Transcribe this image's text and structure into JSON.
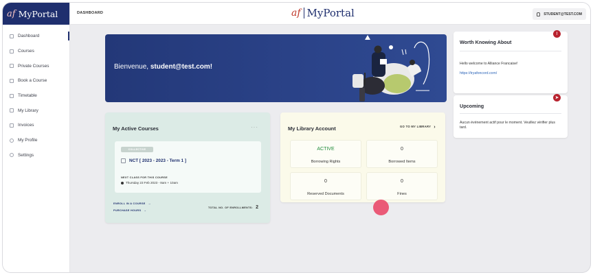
{
  "brand": {
    "mark": "af",
    "name": "MyPortal"
  },
  "topbar": {
    "breadcrumb": "DASHBOARD",
    "user": "STUDENT@TEST.COM"
  },
  "sidebar": {
    "items": [
      {
        "label": "Dashboard",
        "icon": "dashboard-icon"
      },
      {
        "label": "Courses",
        "icon": "courses-icon"
      },
      {
        "label": "Private Courses",
        "icon": "private-courses-icon"
      },
      {
        "label": "Book a Course",
        "icon": "book-course-icon"
      },
      {
        "label": "Timetable",
        "icon": "calendar-icon"
      },
      {
        "label": "My Library",
        "icon": "library-icon"
      },
      {
        "label": "Invoices",
        "icon": "invoice-icon"
      },
      {
        "label": "My Profile",
        "icon": "profile-icon"
      },
      {
        "label": "Settings",
        "icon": "gear-icon"
      }
    ]
  },
  "hero": {
    "greeting": "Bienvenue,",
    "user": "student@test.com!"
  },
  "courses": {
    "title": "My Active Courses",
    "menu": "···",
    "tag": "COLLECTIVE",
    "course_name": "NCT [ 2023 - 2023 - Term 1 ]",
    "next_class_label": "NEXT CLASS FOR THIS COURSE",
    "next_class_value": "Thursday 23 Feb 2023 - 8am + 10am",
    "enroll_link": "ENROLL IN A COURSE",
    "purchase_link": "PURCHASE HOURS",
    "enroll_count_label": "TOTAL NO. OF ENROLLMENTS:",
    "enroll_count": "2"
  },
  "library": {
    "title": "My Library Account",
    "go_link": "GO TO MY LIBRARY",
    "stats": [
      {
        "value": "ACTIVE",
        "label": "Borrowing Rights"
      },
      {
        "value": "0",
        "label": "Borrowed Items"
      },
      {
        "value": "0",
        "label": "Reserved Documents"
      },
      {
        "value": "0",
        "label": "Fines"
      }
    ]
  },
  "worth": {
    "title": "Worth Knowing About",
    "text": "Hello welcome to Alliance Francaise!",
    "link": "https://tryafoncord.com/"
  },
  "upcoming": {
    "title": "Upcoming",
    "text": "Aucun événement actif pour le moment. Veuillez vérifier plus tard."
  },
  "colors": {
    "brand_navy": "#1f2f6e",
    "accent_red": "#b8232f",
    "active_green": "#1f8b3a",
    "pink_dot": "#ea5270"
  }
}
